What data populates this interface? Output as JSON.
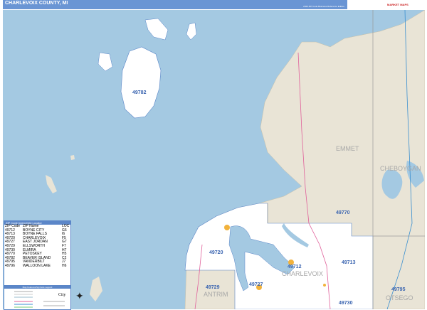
{
  "header": {
    "title": "CHARLEVOIX COUNTY, MI",
    "subtitle": "2026 ZIP Code Business Reference Edition"
  },
  "logo": {
    "text": "MARKET MAPS"
  },
  "colors": {
    "water": "#a4c9e2",
    "land": "#e9e4d6",
    "county": "#ffffff",
    "header": "#6a95d4",
    "zip_label": "#3a64b0"
  },
  "map": {
    "zip_labels": [
      "49782",
      "49770",
      "49720",
      "49712",
      "49713",
      "49729",
      "49727",
      "49730",
      "49795"
    ],
    "county_labels": [
      "EMMET",
      "CHEBOYGAN",
      "CHARLEVOIX",
      "ANTRIM",
      "OTSEGO"
    ]
  },
  "index": {
    "title": "ZIP Code Index/Grid Locator",
    "columns": [
      "ZIP Code",
      "ZIP Name",
      "LOC"
    ],
    "rows": [
      [
        "49712",
        "BOYNE CITY",
        "G6"
      ],
      [
        "49713",
        "BOYNE FALLS",
        "I6"
      ],
      [
        "49720",
        "CHARLEVOIX",
        "F5"
      ],
      [
        "49727",
        "EAST JORDAN",
        "G7"
      ],
      [
        "49729",
        "ELLSWORTH",
        "F7"
      ],
      [
        "49730",
        "ELMIRA",
        "H7"
      ],
      [
        "49770",
        "PETOSKEY",
        "H5"
      ],
      [
        "49782",
        "BEAVER ISLAND",
        "C2"
      ],
      [
        "49795",
        "VANDERBILT",
        "J7"
      ],
      [
        "49796",
        "WALLOON LAKE",
        "H6"
      ]
    ]
  },
  "legend": {
    "title": "Map Features/Symbols Legend",
    "city_label": "City"
  }
}
